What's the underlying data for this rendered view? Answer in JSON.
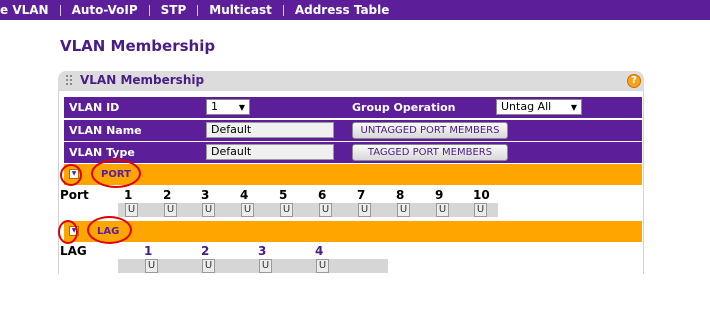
{
  "nav": [
    "e VLAN",
    "Auto-VoIP",
    "STP",
    "Multicast",
    "Address Table"
  ],
  "page_title": "VLAN Membership",
  "panel": {
    "title": "VLAN Membership",
    "help_glyph": "?",
    "vlan_id_label": "VLAN ID",
    "vlan_id_value": "1",
    "group_operation_label": "Group Operation",
    "group_operation_value": "Untag All",
    "vlan_name_label": "VLAN Name",
    "vlan_name_value": "Default",
    "vlan_type_label": "VLAN Type",
    "vlan_type_value": "Default",
    "untagged_button": "UNTAGGED PORT MEMBERS",
    "tagged_button": "TAGGED PORT MEMBERS"
  },
  "port_section": {
    "label": "PORT",
    "row_label": "Port",
    "ports": [
      "1",
      "2",
      "3",
      "4",
      "5",
      "6",
      "7",
      "8",
      "9",
      "10"
    ],
    "states": [
      "U",
      "U",
      "U",
      "U",
      "U",
      "U",
      "U",
      "U",
      "U",
      "U"
    ]
  },
  "lag_section": {
    "label": "LAG",
    "row_label": "LAG",
    "lags": [
      "1",
      "2",
      "3",
      "4"
    ],
    "states": [
      "U",
      "U",
      "U",
      "U"
    ]
  },
  "colors": {
    "nav_bg": "#5c1f99",
    "section_bg": "#ffa500",
    "title_color": "#4a1c86",
    "annotation": "#e00000"
  }
}
